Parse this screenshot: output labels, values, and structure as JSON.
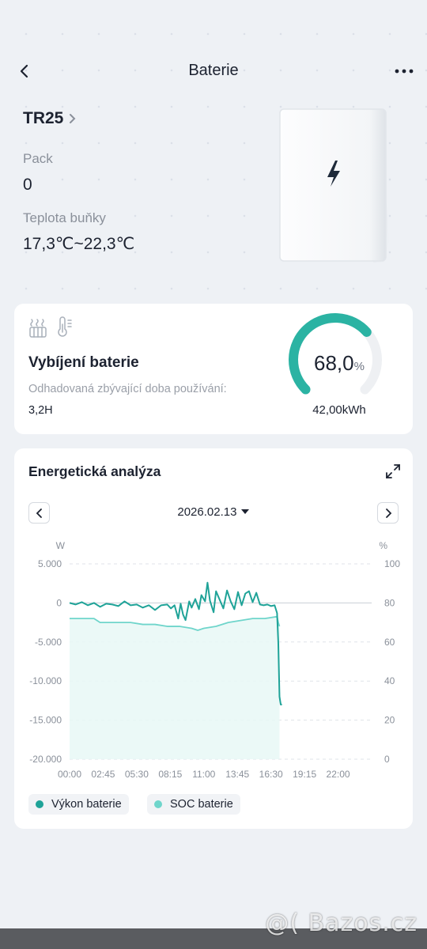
{
  "header": {
    "title": "Baterie"
  },
  "device": {
    "name": "TR25",
    "pack_label": "Pack",
    "pack_value": "0",
    "temp_label": "Teplota buňky",
    "temp_value": "17,3℃~22,3℃"
  },
  "status": {
    "title": "Vybíjení baterie",
    "estimate_label": "Odhadovaná zbývající doba používání:",
    "estimate_value": "3,2H",
    "soc_value": "68,0",
    "soc_unit": "%",
    "soc_fraction": 0.68,
    "energy": "42,00kWh",
    "accent_color": "#2bb3a3"
  },
  "analysis": {
    "title": "Energetická analýza",
    "date": "2026.02.13"
  },
  "chart_data": {
    "type": "line",
    "x_ticks": [
      "00:00",
      "02:45",
      "05:30",
      "08:15",
      "11:00",
      "13:45",
      "16:30",
      "19:15",
      "22:00"
    ],
    "y_left_label": "W",
    "y_right_label": "%",
    "y_left_ticks": [
      "5.000",
      "0",
      "-5.000",
      "-10.000",
      "-15.000",
      "-20.000"
    ],
    "y_right_ticks": [
      "100",
      "80",
      "60",
      "40",
      "20",
      "0"
    ],
    "ylim_left": [
      -20000,
      5000
    ],
    "ylim_right": [
      0,
      100
    ],
    "grid": true,
    "series": [
      {
        "name": "Výkon baterie",
        "axis": "left",
        "color": "#1fa398",
        "x_hours": [
          0,
          0.5,
          1,
          1.5,
          2,
          2.5,
          3,
          3.5,
          4,
          4.5,
          5,
          5.5,
          6,
          6.5,
          7,
          7.5,
          8,
          8.3,
          8.6,
          8.9,
          9.1,
          9.3,
          9.5,
          9.8,
          10,
          10.3,
          10.6,
          10.8,
          11.1,
          11.3,
          11.5,
          11.8,
          12,
          12.3,
          12.6,
          12.9,
          13.2,
          13.5,
          13.8,
          14.1,
          14.4,
          14.7,
          15,
          15.3,
          15.6,
          15.9,
          16.2,
          16.5,
          16.8,
          17,
          17.1,
          17.2,
          17.3,
          17.4
        ],
        "values": [
          0,
          -200,
          100,
          -300,
          0,
          -500,
          -100,
          -200,
          -400,
          200,
          -300,
          -200,
          -600,
          -300,
          -900,
          -300,
          -200,
          -700,
          -300,
          -2000,
          -100,
          -1500,
          -2200,
          200,
          -600,
          500,
          -800,
          1000,
          200,
          2600,
          300,
          -1200,
          1500,
          400,
          -700,
          1600,
          200,
          -800,
          1400,
          -300,
          1200,
          1500,
          100,
          1300,
          -200,
          -300,
          -200,
          -400,
          -300,
          -1300,
          -5000,
          -12000,
          -13000,
          -13000
        ]
      },
      {
        "name": "SOC baterie",
        "axis": "right",
        "color": "#6fd5cb",
        "x_hours": [
          0,
          2,
          2.5,
          4,
          5,
          6,
          7,
          8,
          9,
          10,
          10.5,
          11,
          12,
          13,
          14,
          15,
          16,
          17,
          17.1,
          17.2
        ],
        "values": [
          72,
          72,
          70,
          70,
          70,
          69,
          69,
          68,
          68,
          67,
          66,
          67,
          68,
          70,
          71,
          72,
          72,
          73,
          70,
          68
        ]
      }
    ]
  },
  "legend": {
    "power": "Výkon baterie",
    "soc": "SOC baterie"
  },
  "watermark": "@( Bazos.cz"
}
